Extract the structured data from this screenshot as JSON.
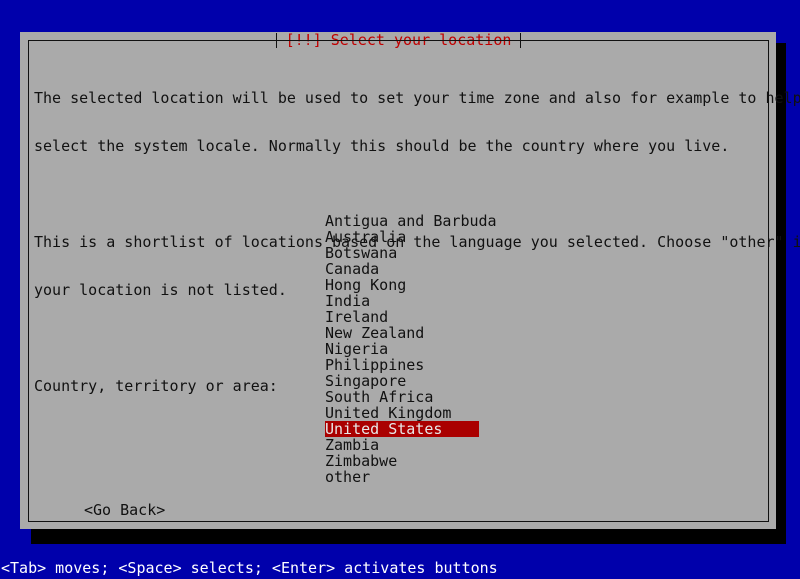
{
  "screen": {
    "background_color": "#0000ab",
    "dialog_background_color": "#aaaaaa",
    "title_color": "#c00000",
    "text_color": "#111111",
    "highlight_background_color": "#aa0000",
    "highlight_text_color": "#e8e8e8",
    "status_text_color": "#ffffff"
  },
  "dialog": {
    "title": "[!!] Select your location",
    "paragraphs": [
      "The selected location will be used to set your time zone and also for example to help",
      "select the system locale. Normally this should be the country where you live.",
      "",
      "This is a shortlist of locations based on the language you selected. Choose \"other\" if",
      "your location is not listed."
    ],
    "list_label": "Country, territory or area:",
    "countries": [
      "Antigua and Barbuda",
      "Australia",
      "Botswana",
      "Canada",
      "Hong Kong",
      "India",
      "Ireland",
      "New Zealand",
      "Nigeria",
      "Philippines",
      "Singapore",
      "South Africa",
      "United Kingdom",
      "United States",
      "Zambia",
      "Zimbabwe",
      "other"
    ],
    "selected_country": "United States",
    "selected_index": 13,
    "go_back_button": "<Go Back>"
  },
  "status_bar": {
    "hint": "<Tab> moves; <Space> selects; <Enter> activates buttons"
  }
}
